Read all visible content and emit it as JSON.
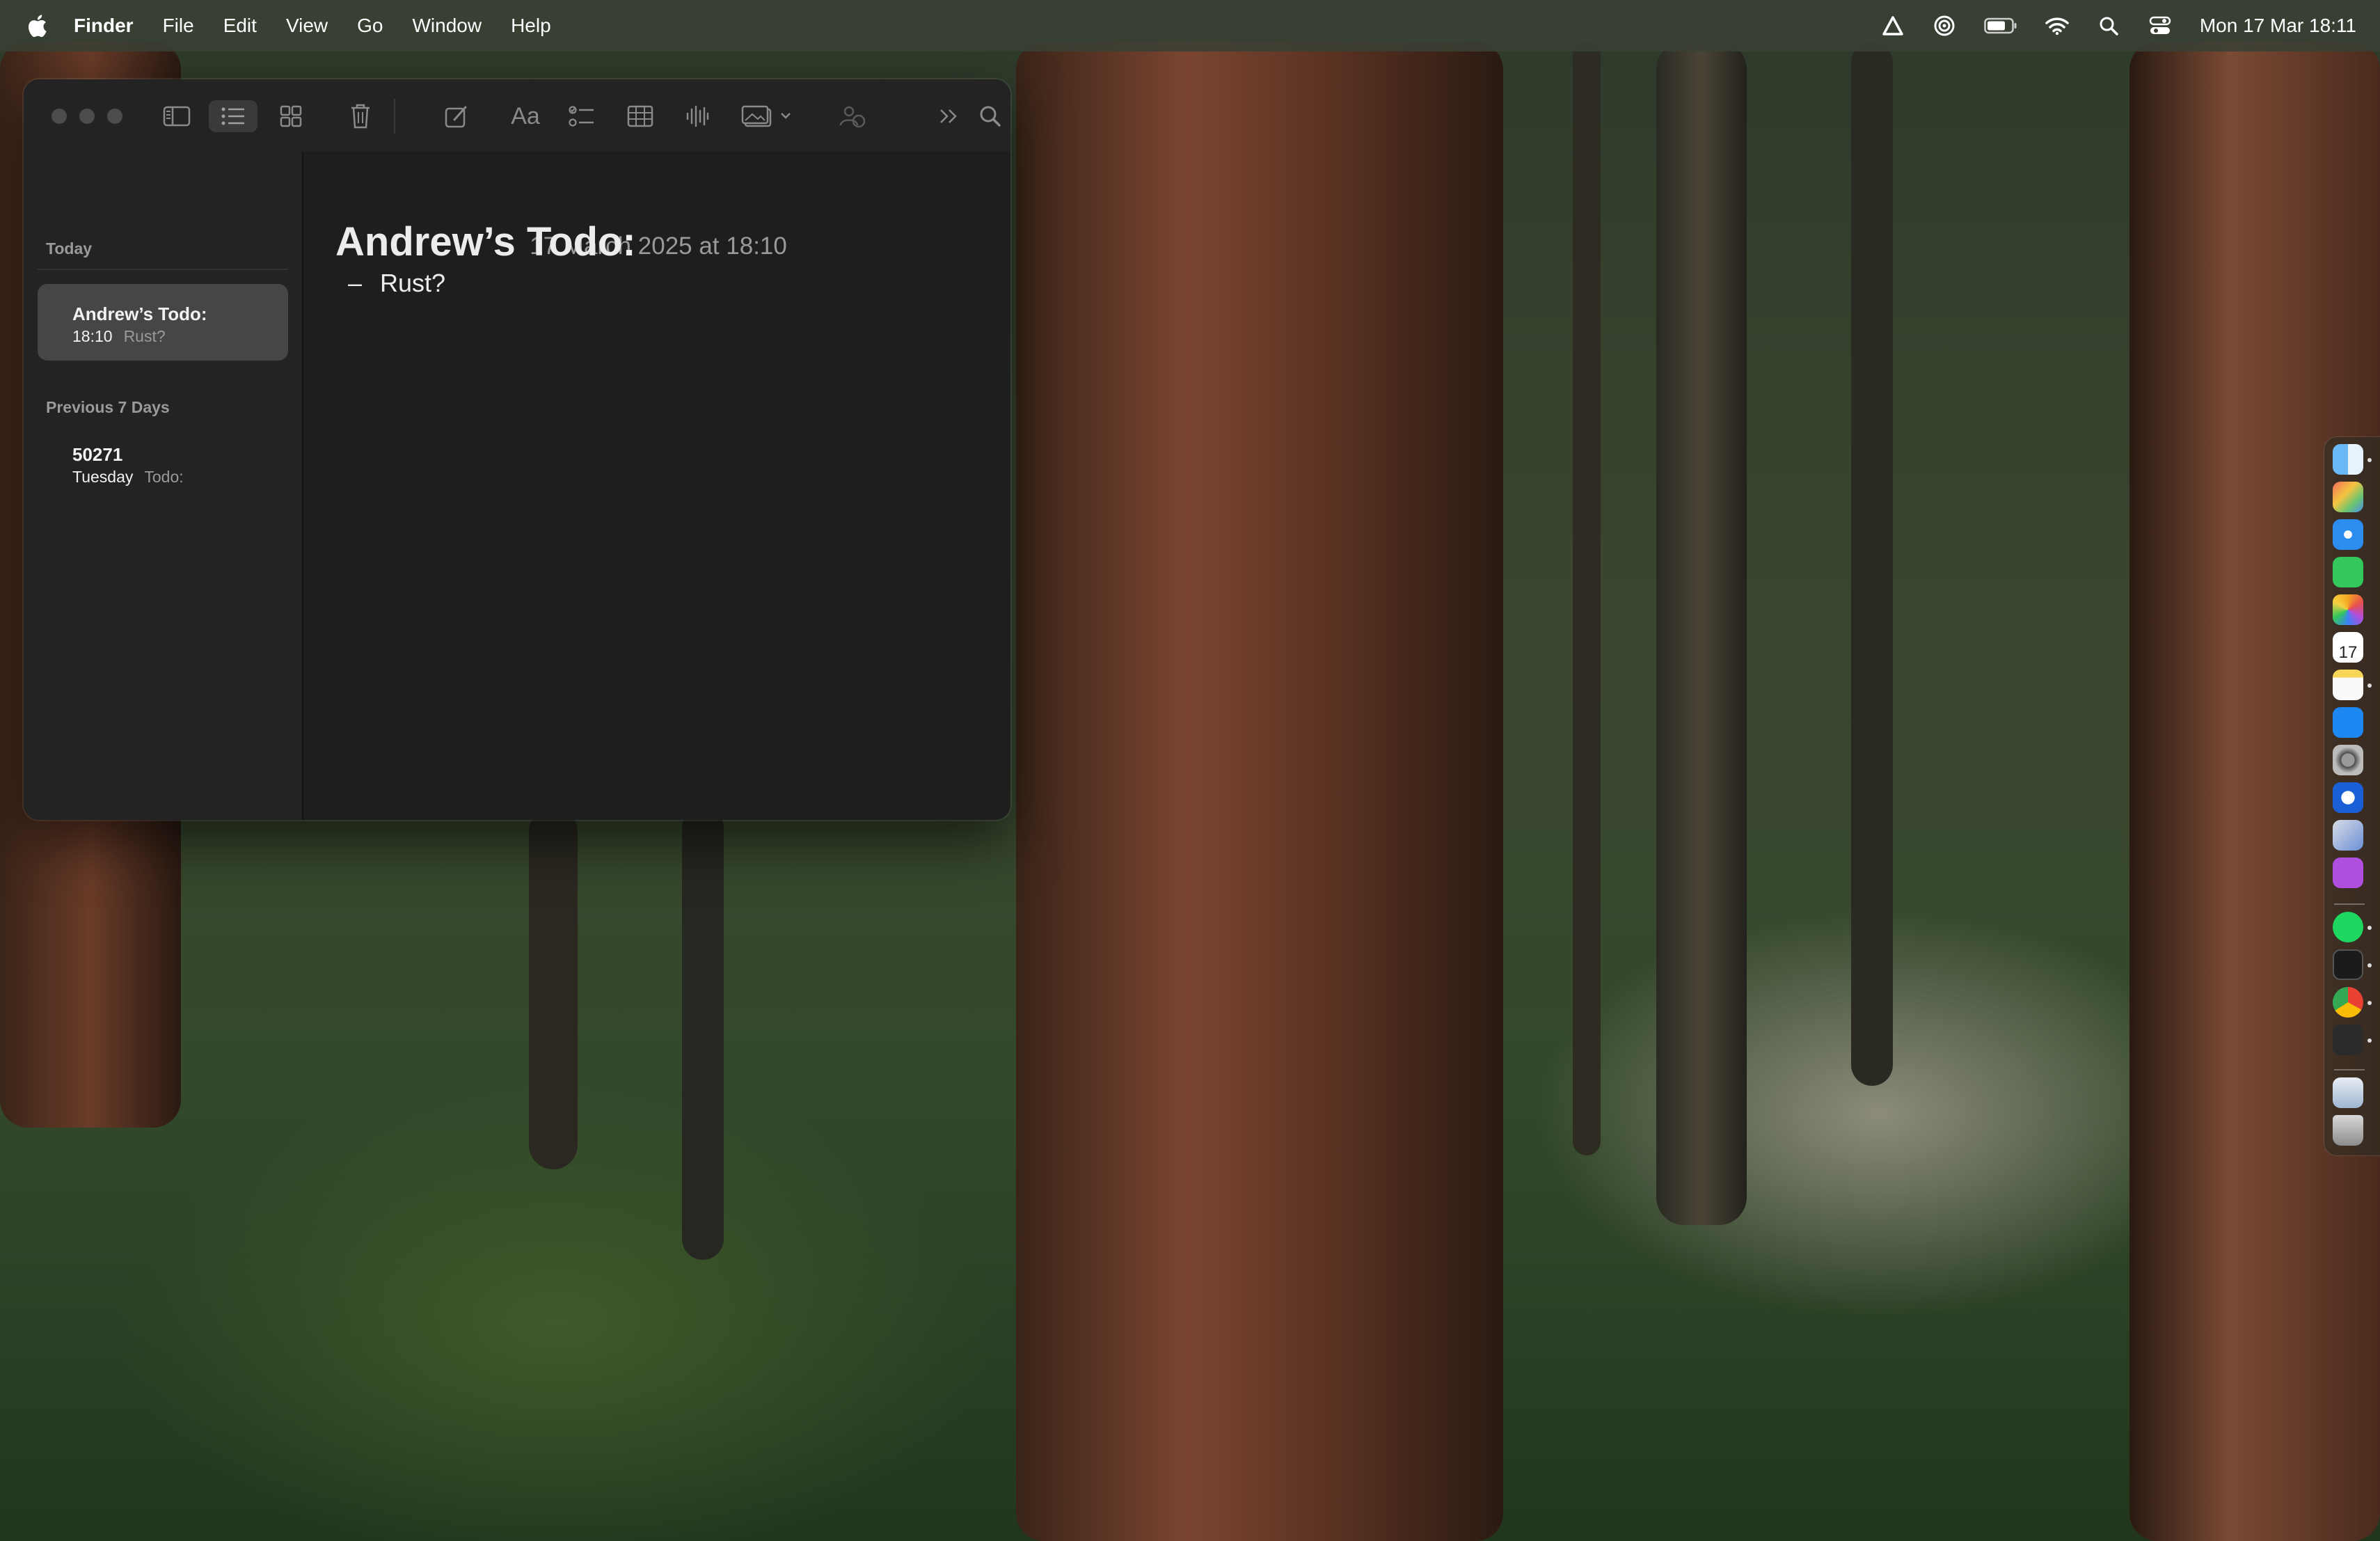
{
  "menubar": {
    "app_name": "Finder",
    "menus": [
      "File",
      "Edit",
      "View",
      "Go",
      "Window",
      "Help"
    ],
    "clock": "Mon 17 Mar  18:11",
    "status_icons": [
      "vpn-triangle-icon",
      "airdrop-icon",
      "battery-icon",
      "wifi-icon",
      "spotlight-icon",
      "control-center-icon"
    ]
  },
  "notes": {
    "toolbar_icons": [
      "sidebar-toggle-icon",
      "list-view-icon",
      "gallery-view-icon",
      "delete-icon",
      "compose-icon",
      "format-icon",
      "checklist-icon",
      "table-icon",
      "audio-icon",
      "media-icon",
      "collaborate-icon",
      "more-icon",
      "search-icon"
    ],
    "sections": [
      {
        "label": "Today",
        "items": [
          {
            "title": "Andrew’s Todo:",
            "time": "18:10",
            "preview": "Rust?",
            "selected": true
          }
        ]
      },
      {
        "label": "Previous 7 Days",
        "items": [
          {
            "title": "50271",
            "time": "Tuesday",
            "preview": "Todo:",
            "selected": false
          }
        ]
      }
    ],
    "editor": {
      "date_stamp": "17 March 2025 at 18:10",
      "heading": "Andrew’s Todo:",
      "bullet_marker": "–",
      "bullet_text": "Rust?"
    }
  },
  "dock": {
    "apps": [
      "finder-icon",
      "launchpad-icon",
      "safari-icon",
      "messages-icon",
      "photos-icon",
      "calendar-icon",
      "notes-icon",
      "app-store-icon",
      "system-settings-icon",
      "1password-icon",
      "xcode-icon",
      "podcasts-icon",
      "spotify-icon",
      "terminal-icon",
      "chrome-icon",
      "unity-icon",
      "downloads-folder-icon",
      "trash-icon"
    ],
    "calendar_day": "17"
  }
}
